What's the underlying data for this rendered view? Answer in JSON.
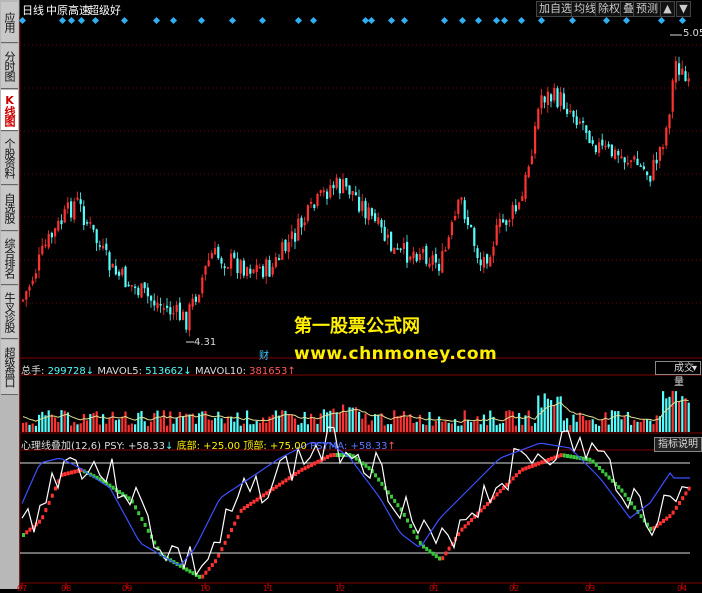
{
  "sidebar": {
    "tabs": [
      {
        "label": "应用",
        "active": false
      },
      {
        "label": "分时图",
        "active": false
      },
      {
        "label": "K线图",
        "active": true
      },
      {
        "label": "个股资料",
        "active": false
      },
      {
        "label": "自选股",
        "active": false
      },
      {
        "label": "综合排名",
        "active": false
      },
      {
        "label": "牛叉诊股",
        "active": false
      },
      {
        "label": "超级盘口",
        "active": false
      }
    ]
  },
  "header": {
    "period": "日线",
    "stock_name": "中原高速",
    "indicator": "超级好",
    "buttons": [
      "加自选",
      "均线",
      "除权",
      "叠",
      "预测"
    ]
  },
  "price_chart": {
    "high_label": "5.05",
    "low_label": "4.31"
  },
  "finance_marker": "财",
  "watermark": {
    "line1": "第一股票公式网",
    "line2": "www.chnmoney.com"
  },
  "volume_panel": {
    "total_label": "总手:",
    "total_value": "299728",
    "mavol5_label": "MAVOL5:",
    "mavol5_value": "513662",
    "mavol10_label": "MAVOL10:",
    "mavol10_value": "381653",
    "selector": "成交量"
  },
  "indicator_panel": {
    "name": "心理线叠加(12,6)",
    "psy_label": "PSY:",
    "psy_value": "+58.33",
    "bottom_label": "底部:",
    "bottom_value": "+25.00",
    "top_label": "顶部:",
    "top_value": "+75.00",
    "psyma_label": "PSYMA:",
    "psyma_value": "+58.33",
    "help_button": "指标说明"
  },
  "date_axis": [
    "07",
    "08",
    "09",
    "10",
    "11",
    "12",
    "01",
    "02",
    "03",
    "04"
  ],
  "colors": {
    "up": "#ff3232",
    "down": "#54fcfc",
    "ma": "#ffffff",
    "psyma": "#3c50ff",
    "psy_up": "#ff3232",
    "psy_down": "#3cc83c",
    "watermark": "#ffef00",
    "marker": "#30b0f0",
    "grid": "#800000"
  }
}
